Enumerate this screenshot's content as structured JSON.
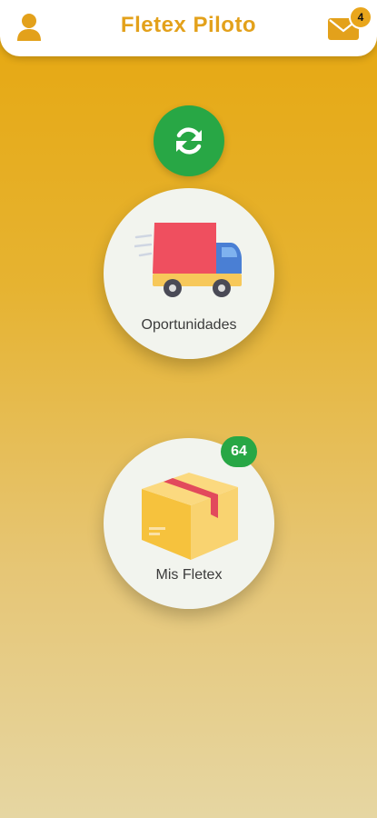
{
  "header": {
    "title": "Fletex Piloto",
    "user_icon": "user-icon",
    "mail_icon": "envelope-icon",
    "mail_badge": "4"
  },
  "refresh": {
    "icon": "sync-icon"
  },
  "cards": {
    "oportunidades": {
      "label": "Oportunidades",
      "icon": "truck-icon"
    },
    "mis_fletex": {
      "label": "Mis Fletex",
      "icon": "box-icon",
      "badge": "64"
    }
  },
  "colors": {
    "accent": "#e3a11b",
    "green": "#28a745",
    "card_bg": "#f2f4ee"
  }
}
